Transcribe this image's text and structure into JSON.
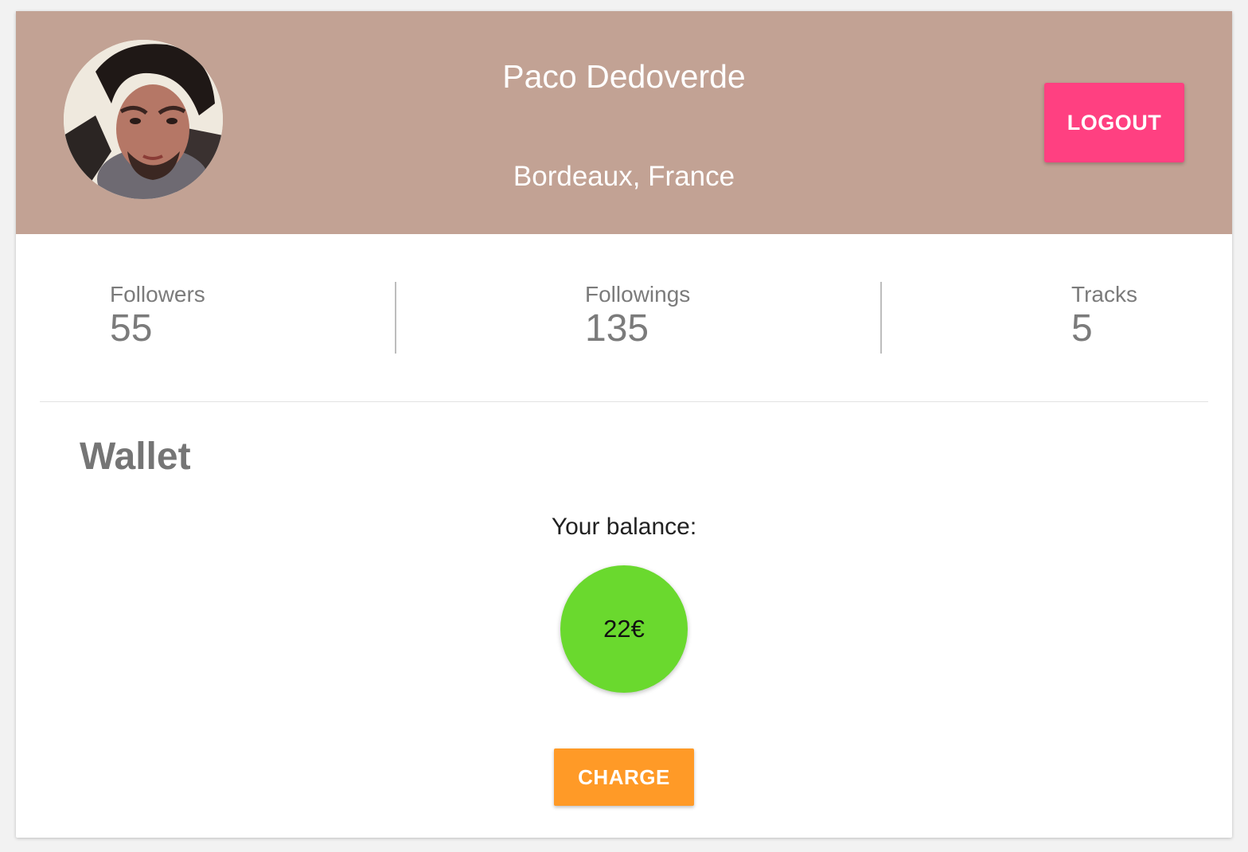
{
  "profile": {
    "name": "Paco Dedoverde",
    "location": "Bordeaux, France",
    "logout_label": "LOGOUT",
    "header_color": "#c2a294"
  },
  "stats": [
    {
      "label": "Followers",
      "value": "55"
    },
    {
      "label": "Followings",
      "value": "135"
    },
    {
      "label": "Tracks",
      "value": "5"
    }
  ],
  "wallet": {
    "title": "Wallet",
    "balance_label": "Your balance:",
    "balance_value": "22€",
    "balance_color": "#6ad92e",
    "charge_label": "CHARGE",
    "charge_color": "#ff9a27"
  },
  "colors": {
    "logout_accent": "#ff4081"
  }
}
